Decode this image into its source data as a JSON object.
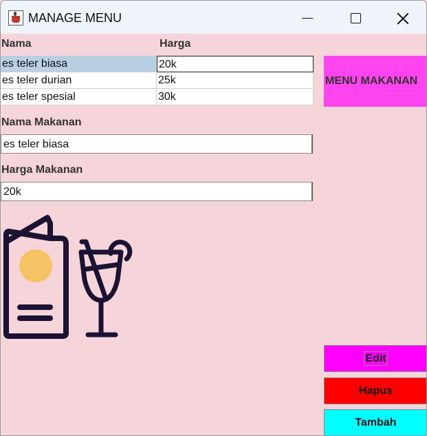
{
  "window": {
    "title": "MANAGE MENU",
    "app_icon": "java-cup-icon"
  },
  "table": {
    "headers": [
      "Nama",
      "Harga"
    ],
    "rows": [
      {
        "name": "es teler biasa",
        "price": "20k",
        "selected": true
      },
      {
        "name": "es teler durian",
        "price": "25k",
        "selected": false
      },
      {
        "name": "es teler spesial",
        "price": "30k",
        "selected": false
      }
    ]
  },
  "form": {
    "nama_label": "Nama Makanan",
    "nama_value": "es teler biasa",
    "harga_label": "Harga Makanan",
    "harga_value": "20k"
  },
  "menu_label": "MENU MAKANAN",
  "buttons": {
    "edit": "Edit",
    "hapus": "Hapus",
    "tambah": "Tambah"
  },
  "colors": {
    "background": "#f5d5d9",
    "menu_label_bg": "#ff44f0",
    "edit_bg": "#ff00ff",
    "hapus_bg": "#ff0000",
    "tambah_bg": "#00ffff",
    "icon_stroke": "#1c1233",
    "icon_accent": "#f5c264"
  },
  "illustration": {
    "icons": [
      "menu-book-icon",
      "drink-glass-icon"
    ]
  }
}
